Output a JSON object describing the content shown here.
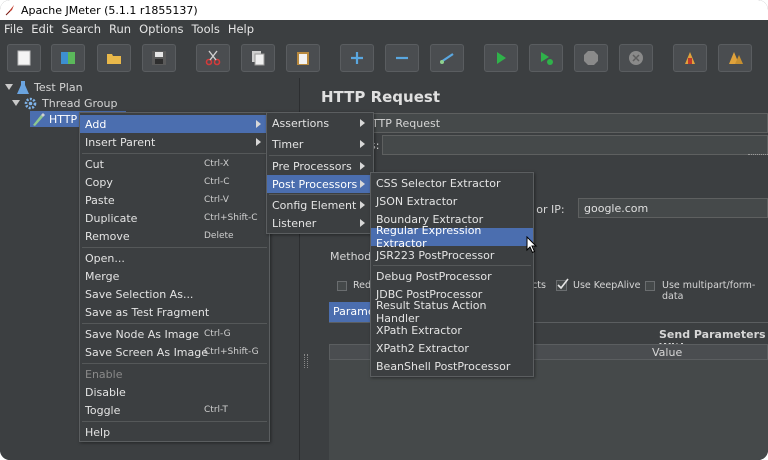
{
  "window": {
    "title": "Apache JMeter (5.1.1 r1855137)"
  },
  "menubar": [
    "File",
    "Edit",
    "Search",
    "Run",
    "Options",
    "Tools",
    "Help"
  ],
  "toolbar": {
    "buttons": [
      "new-icon",
      "templates-icon",
      "open-icon",
      "save-icon",
      "cut-icon",
      "copy-icon",
      "paste-icon",
      "expand-icon",
      "collapse-icon",
      "toggle-icon",
      "start-icon",
      "start-no-pause-icon",
      "stop-icon",
      "shutdown-icon",
      "clear-icon",
      "clear-all-icon"
    ]
  },
  "tree": {
    "test_plan": "Test Plan",
    "thread_group": "Thread Group",
    "http": "HTTP"
  },
  "right_pane": {
    "heading": "HTTP Request",
    "name_value": "TTP Request",
    "comments_label": "s:",
    "server_label": "ne or IP:",
    "server_value": "google.com",
    "method_label": "Method:",
    "redirect_label": "Red",
    "redirects_label": "cts",
    "keepalive_label": "Use KeepAlive",
    "multipart_label": "Use multipart/form-data",
    "params_tab": "Parame",
    "send_params": "Send Parameters With",
    "value_col": "Value"
  },
  "context_menu": {
    "items": [
      {
        "label": "Add",
        "submenu": true,
        "highlighted": true
      },
      {
        "label": "Insert Parent",
        "submenu": true
      },
      {
        "label": "Cut",
        "shortcut": "Ctrl-X"
      },
      {
        "label": "Copy",
        "shortcut": "Ctrl-C"
      },
      {
        "label": "Paste",
        "shortcut": "Ctrl-V"
      },
      {
        "label": "Duplicate",
        "shortcut": "Ctrl+Shift-C"
      },
      {
        "label": "Remove",
        "shortcut": "Delete"
      },
      {
        "label": "Open..."
      },
      {
        "label": "Merge"
      },
      {
        "label": "Save Selection As..."
      },
      {
        "label": "Save as Test Fragment"
      },
      {
        "label": "Save Node As Image",
        "shortcut": "Ctrl-G"
      },
      {
        "label": "Save Screen As Image",
        "shortcut": "Ctrl+Shift-G"
      },
      {
        "label": "Enable",
        "disabled": true
      },
      {
        "label": "Disable"
      },
      {
        "label": "Toggle",
        "shortcut": "Ctrl-T"
      },
      {
        "label": "Help"
      }
    ]
  },
  "add_menu": {
    "items": [
      "Assertions",
      "Timer",
      "Pre Processors",
      "Post Processors",
      "Config Element",
      "Listener"
    ],
    "highlighted": "Post Processors"
  },
  "post_menu": {
    "items": [
      "CSS Selector Extractor",
      "JSON Extractor",
      "Boundary Extractor",
      "Regular Expression Extractor",
      "JSR223 PostProcessor",
      "Debug PostProcessor",
      "JDBC PostProcessor",
      "Result Status Action Handler",
      "XPath Extractor",
      "XPath2 Extractor",
      "BeanShell PostProcessor"
    ],
    "highlighted": "Regular Expression Extractor"
  },
  "colors": {
    "highlight": "#4b6eaf",
    "background": "#3c3f41"
  }
}
